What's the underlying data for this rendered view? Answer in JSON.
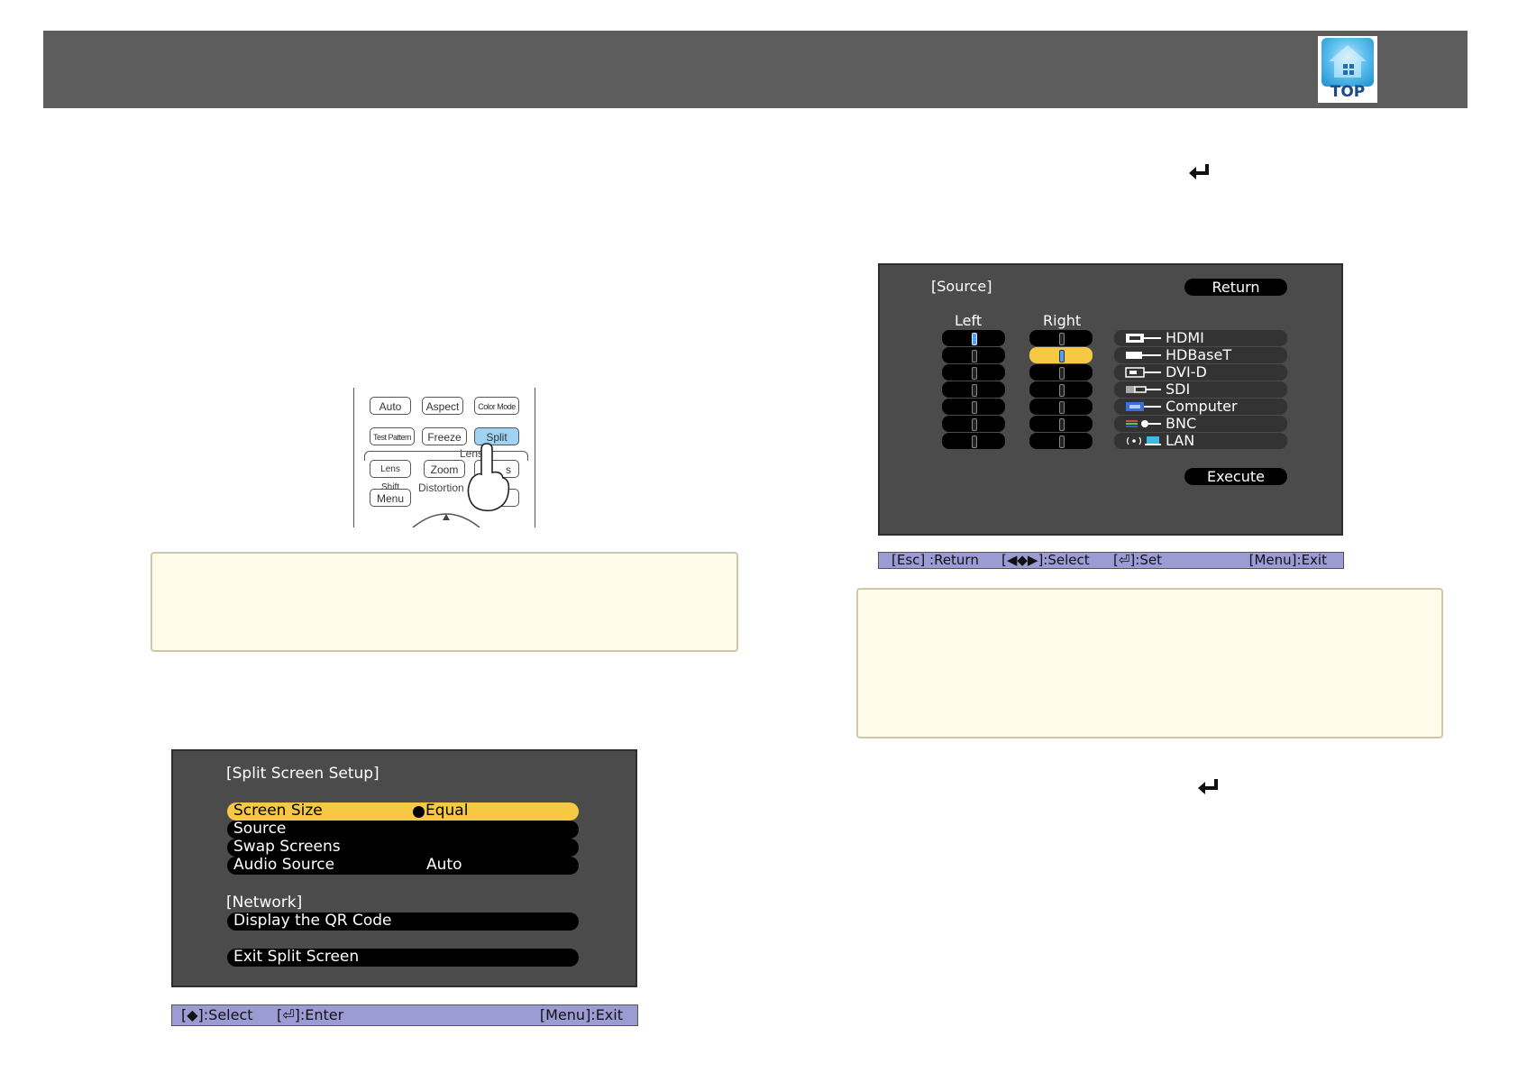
{
  "header": {
    "logo_label": "TOP"
  },
  "remote": {
    "buttons": [
      "Auto",
      "Aspect",
      "Color Mode",
      "Test Pattern",
      "Freeze",
      "Split",
      "Lens Shift",
      "Zoom",
      "s",
      "Menu"
    ],
    "labels": {
      "lens": "Lens",
      "distortion": "Distortion"
    }
  },
  "split_setup": {
    "title": "[Split Screen Setup]",
    "items": [
      {
        "label": "Screen Size",
        "value": "Equal"
      },
      {
        "label": "Source",
        "value": ""
      },
      {
        "label": "Swap Screens",
        "value": ""
      },
      {
        "label": "Audio Source",
        "value": "Auto"
      }
    ],
    "network_header": "[Network]",
    "qr_label": "Display the QR Code",
    "exit_label": "Exit Split Screen",
    "status": {
      "select": "[◆]:Select",
      "enter": "[⏎]:Enter",
      "exit": "[Menu]:Exit"
    }
  },
  "source_menu": {
    "title": "[Source]",
    "return_label": "Return",
    "left_header": "Left",
    "right_header": "Right",
    "sources": [
      "HDMI",
      "HDBaseT",
      "DVI-D",
      "SDI",
      "Computer",
      "BNC",
      "LAN"
    ],
    "execute_label": "Execute",
    "status": {
      "return": "[Esc] :Return",
      "select": "[◀◆▶]:Select",
      "set": "[⏎]:Set",
      "exit": "[Menu]:Exit"
    }
  }
}
